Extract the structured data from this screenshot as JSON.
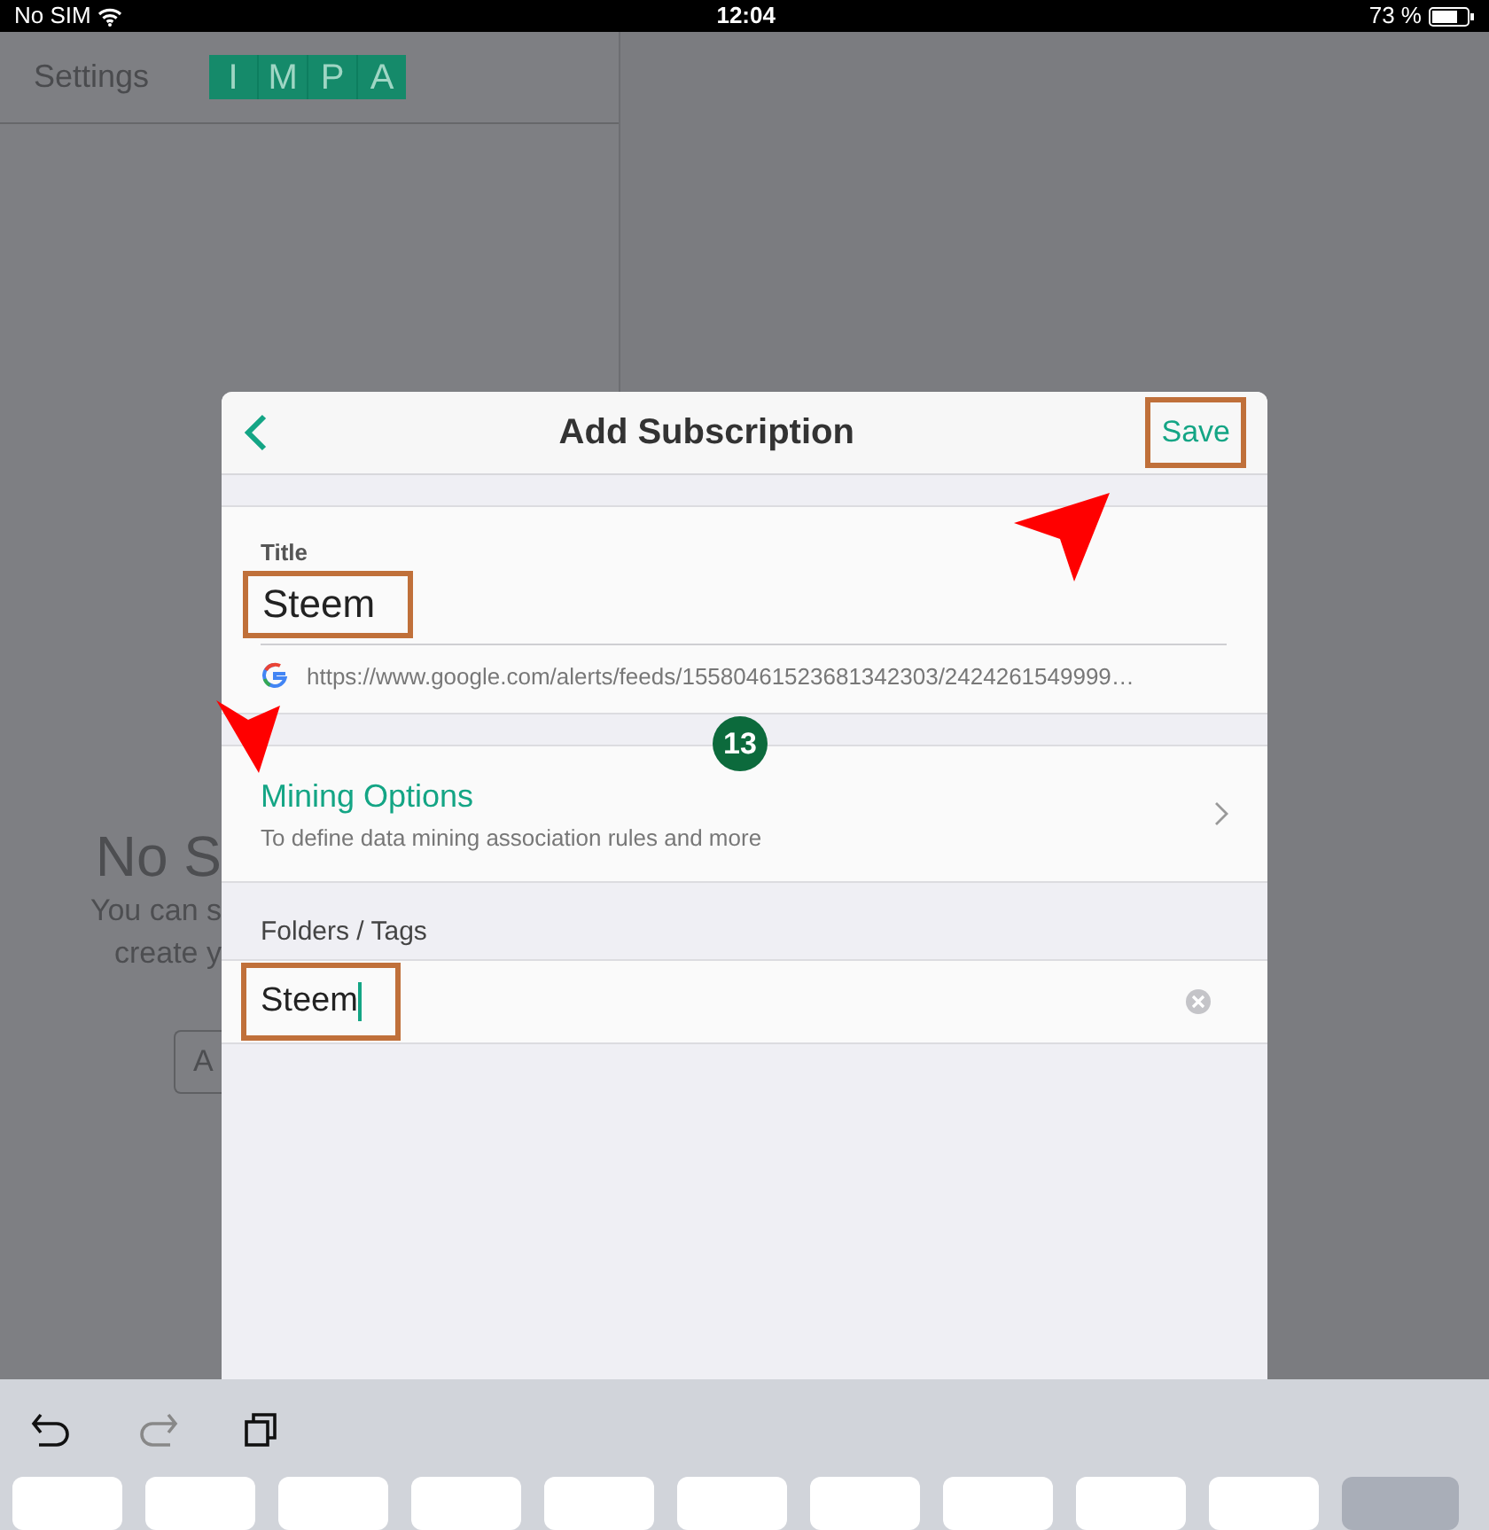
{
  "status_bar": {
    "carrier": "No SIM",
    "time": "12:04",
    "battery": "73 %"
  },
  "background": {
    "title": "Settings",
    "logo_letters": [
      "I",
      "M",
      "P",
      "A"
    ],
    "empty_title": "No S",
    "empty_lines": [
      "You can s",
      "create y"
    ],
    "button": "A"
  },
  "dialog": {
    "title": "Add Subscription",
    "save": "Save",
    "title_label": "Title",
    "title_value": "Steem",
    "feed_url": "https://www.google.com/alerts/feeds/15580461523681342303/2424261549999…",
    "mining": {
      "title": "Mining Options",
      "subtitle": "To define data mining association rules and more"
    },
    "folders_label": "Folders / Tags",
    "folder_value": "Steem"
  },
  "annotations": {
    "step_badge": "13"
  }
}
